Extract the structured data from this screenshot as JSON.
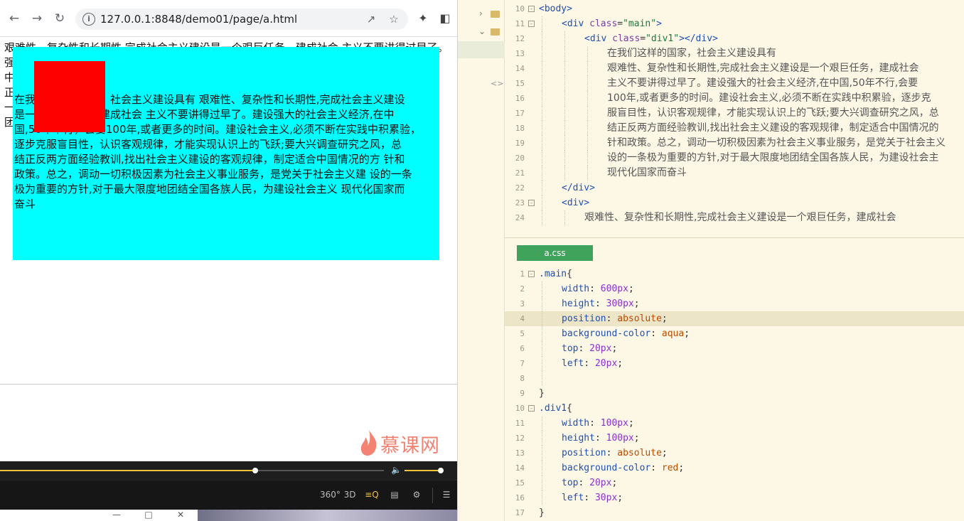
{
  "browser": {
    "url": "127.0.0.1:8848/demo01/page/a.html",
    "body_text_lines": [
      "艰难性、复杂性和长期性,完成社会主义建设是一个艰巨任务，建成社会 主义不要讲得过早了。",
      "强",
      "中                                                                                                                                                      不断",
      "正                                                                                                                                                      之风,",
      "一                                                                                                                                                      总之",
      "团                                                                                                                                                      最大"
    ],
    "main_text_lines": [
      "在我们这样的国家，社会主义建设具有 艰难性、复杂性和长期性,完成社会主义建设",
      "是一个艰巨任务，建成社会 主义不要讲得过早了。建设强大的社会主义经济,在中",
      "国,50年不行，会要100年,或者更多的时间。建设社会主义,必须不断在实践中积累验，",
      "逐步克服盲目性，认识客观规律，才能实现认识上的飞跃;要大兴调查研究之风，总",
      "结正反两方面经验教训,找出社会主义建设的客观规律，制定适合中国情况的方 针和",
      "政策。总之，调动一切积极因素为社会主义事业服务，是党关于社会主义建 设的一条",
      "极为重要的方针,对于最大限度地团结全国各族人民，为建设社会主义 现代化国家而",
      "奋斗"
    ]
  },
  "player": {
    "watermark": "慕课网",
    "progress": 0.665,
    "volume": 0.95,
    "controls": [
      "360°",
      "3D",
      "≡Q",
      "▤",
      "⚙",
      "☰"
    ]
  },
  "editor": {
    "css_tab": "a.css",
    "html_lines": [
      {
        "n": "10",
        "fold": "-",
        "indent": 0,
        "parts": [
          [
            "tag",
            "<body>"
          ]
        ]
      },
      {
        "n": "11",
        "fold": "-",
        "indent": 1,
        "parts": [
          [
            "tag",
            "<div "
          ],
          [
            "attr",
            "class"
          ],
          [
            "punc",
            "="
          ],
          [
            "str",
            "\"main\""
          ],
          [
            "tag",
            ">"
          ]
        ]
      },
      {
        "n": "12",
        "fold": "",
        "indent": 2,
        "parts": [
          [
            "tag",
            "<div "
          ],
          [
            "attr",
            "class"
          ],
          [
            "punc",
            "="
          ],
          [
            "str",
            "\"div1\""
          ],
          [
            "tag",
            "></div>"
          ]
        ]
      },
      {
        "n": "13",
        "fold": "",
        "indent": 3,
        "parts": [
          [
            "cjk",
            "在我们这样的国家，社会主义建设具有"
          ]
        ]
      },
      {
        "n": "14",
        "fold": "",
        "indent": 3,
        "parts": [
          [
            "cjk",
            "艰难性、复杂性和长期性,完成社会主义建设是一个艰巨任务，建成社会"
          ]
        ]
      },
      {
        "n": "15",
        "fold": "",
        "indent": 3,
        "parts": [
          [
            "cjk",
            "主义不要讲得过早了。建设强大的社会主义经济,在中国,50年不行,会要"
          ]
        ]
      },
      {
        "n": "16",
        "fold": "",
        "indent": 3,
        "parts": [
          [
            "cjk",
            "100年,或者更多的时间。建设社会主义,必须不断在实践中积累验，逐步克"
          ]
        ]
      },
      {
        "n": "17",
        "fold": "",
        "indent": 3,
        "parts": [
          [
            "cjk",
            "服盲目性，认识客观规律，才能实现认识上的飞跃;要大兴调查研究之风，总"
          ]
        ]
      },
      {
        "n": "18",
        "fold": "",
        "indent": 3,
        "parts": [
          [
            "cjk",
            "结正反两方面经验教训,找出社会主义建设的客观规律，制定适合中国情况的"
          ]
        ]
      },
      {
        "n": "19",
        "fold": "",
        "indent": 3,
        "parts": [
          [
            "cjk",
            "针和政策。总之，调动一切积极因素为社会主义事业服务，是党关于社会主义"
          ]
        ]
      },
      {
        "n": "20",
        "fold": "",
        "indent": 3,
        "parts": [
          [
            "cjk",
            "设的一条极为重要的方针,对于最大限度地团结全国各族人民，为建设社会主"
          ]
        ]
      },
      {
        "n": "21",
        "fold": "",
        "indent": 3,
        "parts": [
          [
            "cjk",
            "现代化国家而奋斗"
          ]
        ]
      },
      {
        "n": "22",
        "fold": "",
        "indent": 1,
        "parts": [
          [
            "tag",
            "</div>"
          ]
        ]
      },
      {
        "n": "23",
        "fold": "-",
        "indent": 1,
        "parts": [
          [
            "tag",
            "<div>"
          ]
        ]
      },
      {
        "n": "24",
        "fold": "",
        "indent": 2,
        "parts": [
          [
            "cjk",
            "艰难性、复杂性和长期性,完成社会主义建设是一个艰巨任务，建成社会"
          ]
        ]
      }
    ],
    "css_lines": [
      {
        "n": "1",
        "fold": "-",
        "indent": 0,
        "hl": false,
        "parts": [
          [
            "sel",
            ".main"
          ],
          [
            "punc",
            "{"
          ]
        ]
      },
      {
        "n": "2",
        "fold": "",
        "indent": 1,
        "hl": false,
        "parts": [
          [
            "prop",
            "width"
          ],
          [
            "punc",
            ": "
          ],
          [
            "num",
            "600px"
          ],
          [
            "punc",
            ";"
          ]
        ]
      },
      {
        "n": "3",
        "fold": "",
        "indent": 1,
        "hl": false,
        "parts": [
          [
            "prop",
            "height"
          ],
          [
            "punc",
            ": "
          ],
          [
            "num",
            "300px"
          ],
          [
            "punc",
            ";"
          ]
        ]
      },
      {
        "n": "4",
        "fold": "",
        "indent": 1,
        "hl": true,
        "parts": [
          [
            "prop",
            "position"
          ],
          [
            "punc",
            ": "
          ],
          [
            "kw",
            "absolute"
          ],
          [
            "punc",
            ";"
          ]
        ]
      },
      {
        "n": "5",
        "fold": "",
        "indent": 1,
        "hl": false,
        "parts": [
          [
            "prop",
            "background-color"
          ],
          [
            "punc",
            ": "
          ],
          [
            "kw",
            "aqua"
          ],
          [
            "punc",
            ";"
          ]
        ]
      },
      {
        "n": "6",
        "fold": "",
        "indent": 1,
        "hl": false,
        "parts": [
          [
            "prop",
            "top"
          ],
          [
            "punc",
            ": "
          ],
          [
            "num",
            "20px"
          ],
          [
            "punc",
            ";"
          ]
        ]
      },
      {
        "n": "7",
        "fold": "",
        "indent": 1,
        "hl": false,
        "parts": [
          [
            "prop",
            "left"
          ],
          [
            "punc",
            ": "
          ],
          [
            "num",
            "20px"
          ],
          [
            "punc",
            ";"
          ]
        ]
      },
      {
        "n": "8",
        "fold": "",
        "indent": 1,
        "hl": false,
        "parts": []
      },
      {
        "n": "9",
        "fold": "",
        "indent": 0,
        "hl": false,
        "parts": [
          [
            "punc",
            "}"
          ]
        ]
      },
      {
        "n": "10",
        "fold": "-",
        "indent": 0,
        "hl": false,
        "parts": [
          [
            "sel",
            ".div1"
          ],
          [
            "punc",
            "{"
          ]
        ]
      },
      {
        "n": "11",
        "fold": "",
        "indent": 1,
        "hl": false,
        "parts": [
          [
            "prop",
            "width"
          ],
          [
            "punc",
            ": "
          ],
          [
            "num",
            "100px"
          ],
          [
            "punc",
            ";"
          ]
        ]
      },
      {
        "n": "12",
        "fold": "",
        "indent": 1,
        "hl": false,
        "parts": [
          [
            "prop",
            "height"
          ],
          [
            "punc",
            ": "
          ],
          [
            "num",
            "100px"
          ],
          [
            "punc",
            ";"
          ]
        ]
      },
      {
        "n": "13",
        "fold": "",
        "indent": 1,
        "hl": false,
        "parts": [
          [
            "prop",
            "position"
          ],
          [
            "punc",
            ": "
          ],
          [
            "kw",
            "absolute"
          ],
          [
            "punc",
            ";"
          ]
        ]
      },
      {
        "n": "14",
        "fold": "",
        "indent": 1,
        "hl": false,
        "parts": [
          [
            "prop",
            "background-color"
          ],
          [
            "punc",
            ": "
          ],
          [
            "kw",
            "red"
          ],
          [
            "punc",
            ";"
          ]
        ]
      },
      {
        "n": "15",
        "fold": "",
        "indent": 1,
        "hl": false,
        "parts": [
          [
            "prop",
            "top"
          ],
          [
            "punc",
            ": "
          ],
          [
            "num",
            "20px"
          ],
          [
            "punc",
            ";"
          ]
        ]
      },
      {
        "n": "16",
        "fold": "",
        "indent": 1,
        "hl": false,
        "parts": [
          [
            "prop",
            "left"
          ],
          [
            "punc",
            ": "
          ],
          [
            "num",
            "30px"
          ],
          [
            "punc",
            ";"
          ]
        ]
      },
      {
        "n": "17",
        "fold": "",
        "indent": 0,
        "hl": false,
        "parts": [
          [
            "punc",
            "}"
          ]
        ]
      }
    ]
  },
  "colors": {
    "main_bg": "#00ffff",
    "div1_bg": "#ff0000",
    "editor_bg": "#fdf8e6",
    "tab_green": "#3fa35b",
    "progress": "#f3c43a"
  }
}
